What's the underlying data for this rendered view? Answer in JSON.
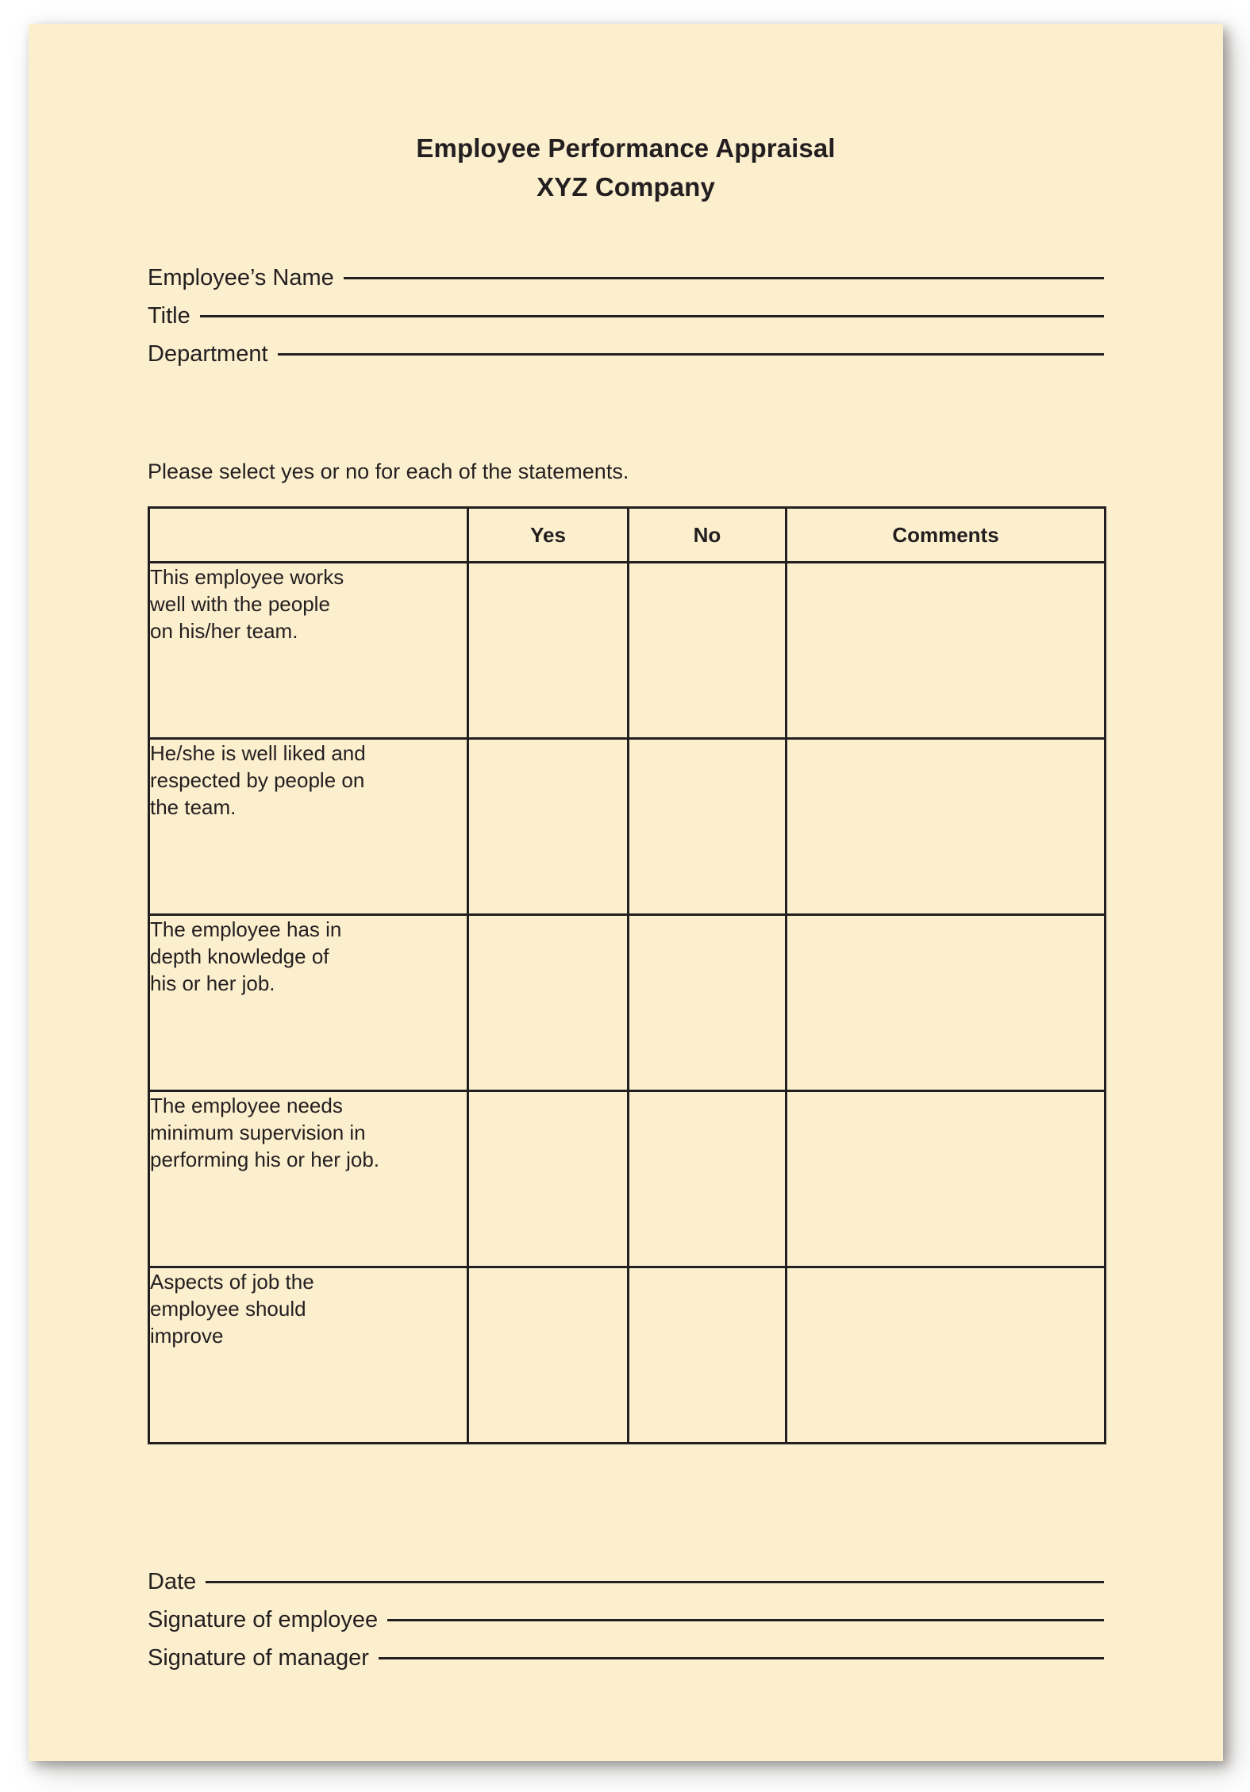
{
  "document": {
    "title_line1": "Employee Performance Appraisal",
    "title_line2": "XYZ Company",
    "instruction": "Please select yes or no for each of the statements."
  },
  "colors": {
    "paper": "#fcefce",
    "ink": "#231f20",
    "canvas": "#ffffff"
  },
  "header_fields": [
    {
      "label": "Employee’s Name"
    },
    {
      "label": "Title"
    },
    {
      "label": "Department"
    }
  ],
  "table": {
    "columns": [
      "",
      "Yes",
      "No",
      "Comments"
    ],
    "rows": [
      {
        "statement": "This employee works\nwell with the people\non his/her team.",
        "yes": "",
        "no": "",
        "comments": ""
      },
      {
        "statement": "He/she is well liked and\nrespected by people on\nthe team.",
        "yes": "",
        "no": "",
        "comments": ""
      },
      {
        "statement": "The employee has in\ndepth knowledge of\nhis or her job.",
        "yes": "",
        "no": "",
        "comments": ""
      },
      {
        "statement": "The employee needs\nminimum supervision in\nperforming his or her job.",
        "yes": "",
        "no": "",
        "comments": ""
      },
      {
        "statement": "Aspects of job the\nemployee should\nimprove",
        "yes": "",
        "no": "",
        "comments": ""
      }
    ]
  },
  "footer_fields": [
    {
      "label": "Date"
    },
    {
      "label": "Signature of employee"
    },
    {
      "label": "Signature of manager"
    }
  ]
}
